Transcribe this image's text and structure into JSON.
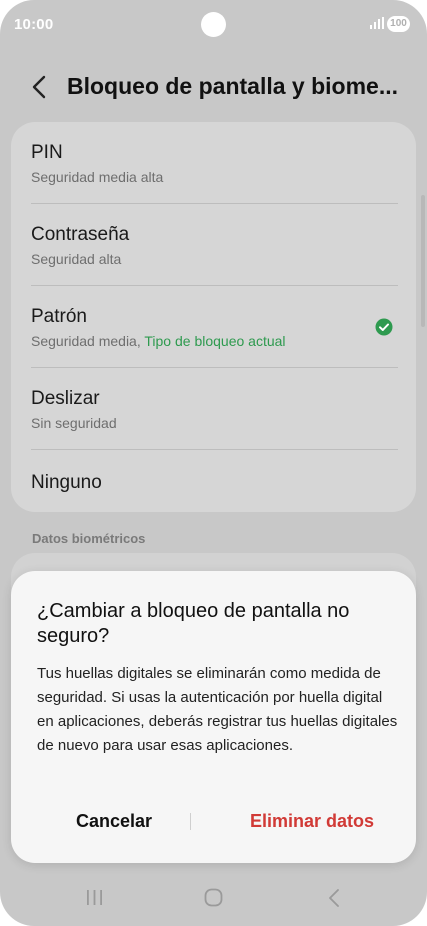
{
  "status_bar": {
    "time": "10:00",
    "battery": "100"
  },
  "header": {
    "title": "Bloqueo de pantalla y biome..."
  },
  "lock_options": [
    {
      "name": "PIN",
      "description": "Seguridad media alta"
    },
    {
      "name": "Contraseña",
      "description": "Seguridad alta"
    },
    {
      "name": "Patrón",
      "description": "Seguridad media, ",
      "current_label": "Tipo de bloqueo actual",
      "selected": true
    },
    {
      "name": "Deslizar",
      "description": "Sin seguridad"
    },
    {
      "name": "Ninguno"
    }
  ],
  "section": {
    "biometrics_label": "Datos biométricos"
  },
  "dialog": {
    "title": "¿Cambiar a bloqueo de pantalla no seguro?",
    "body": "Tus huellas digitales se eliminarán como medida de seguridad. Si usas la autenticación por huella digital en aplicaciones, deberás registrar tus huellas digitales de nuevo para usar esas aplicaciones.",
    "cancel_label": "Cancelar",
    "confirm_label": "Eliminar datos"
  },
  "icons": {
    "back": "back-arrow-icon",
    "check": "check-circle-icon",
    "recents": "recents-icon",
    "home": "home-icon",
    "nav_back": "nav-back-icon"
  },
  "colors": {
    "accent_green": "#2e9a4f",
    "destructive_red": "#d13a36"
  }
}
